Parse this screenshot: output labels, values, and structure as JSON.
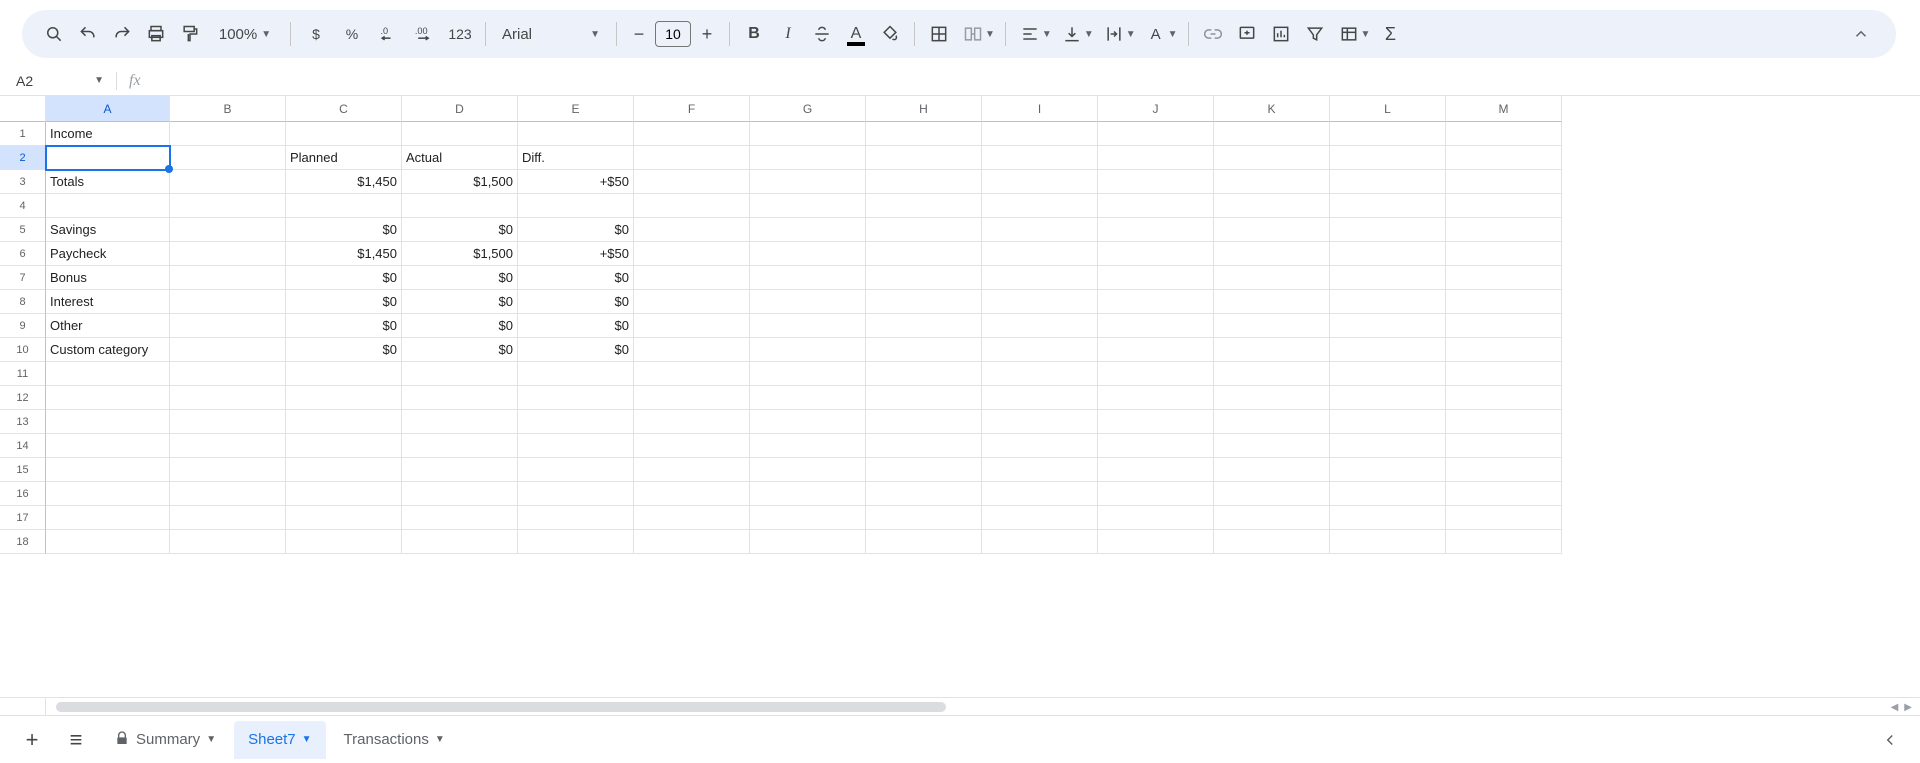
{
  "toolbar": {
    "zoom": "100%",
    "currency_symbol": "$",
    "percent_symbol": "%",
    "dec_less_label": ".0",
    "dec_more_label": ".00",
    "num_format_label": "123",
    "font_name": "Arial",
    "font_size": "10"
  },
  "name_box": {
    "ref": "A2"
  },
  "formula_bar": {
    "value": ""
  },
  "columns": [
    "A",
    "B",
    "C",
    "D",
    "E",
    "F",
    "G",
    "H",
    "I",
    "J",
    "K",
    "L",
    "M"
  ],
  "active_cell": "A2",
  "rows": [
    {
      "n": 1,
      "cells": {
        "A": "Income"
      }
    },
    {
      "n": 2,
      "cells": {
        "C": "Planned",
        "D": "Actual",
        "E": "Diff."
      }
    },
    {
      "n": 3,
      "cells": {
        "A": "Totals",
        "C": "$1,450",
        "D": "$1,500",
        "E": "+$50"
      }
    },
    {
      "n": 4,
      "cells": {}
    },
    {
      "n": 5,
      "cells": {
        "A": "Savings",
        "C": "$0",
        "D": "$0",
        "E": "$0"
      }
    },
    {
      "n": 6,
      "cells": {
        "A": "Paycheck",
        "C": "$1,450",
        "D": "$1,500",
        "E": "+$50"
      }
    },
    {
      "n": 7,
      "cells": {
        "A": "Bonus",
        "C": "$0",
        "D": "$0",
        "E": "$0"
      }
    },
    {
      "n": 8,
      "cells": {
        "A": "Interest",
        "C": "$0",
        "D": "$0",
        "E": "$0"
      }
    },
    {
      "n": 9,
      "cells": {
        "A": "Other",
        "C": "$0",
        "D": "$0",
        "E": "$0"
      }
    },
    {
      "n": 10,
      "cells": {
        "A": "Custom category",
        "C": "$0",
        "D": "$0",
        "E": "$0"
      }
    },
    {
      "n": 11,
      "cells": {}
    },
    {
      "n": 12,
      "cells": {}
    },
    {
      "n": 13,
      "cells": {}
    },
    {
      "n": 14,
      "cells": {}
    },
    {
      "n": 15,
      "cells": {}
    },
    {
      "n": 16,
      "cells": {}
    },
    {
      "n": 17,
      "cells": {}
    },
    {
      "n": 18,
      "cells": {}
    }
  ],
  "sheet_tabs": {
    "tabs": [
      {
        "id": "summary",
        "label": "Summary",
        "locked": true,
        "active": false
      },
      {
        "id": "sheet7",
        "label": "Sheet7",
        "locked": false,
        "active": true
      },
      {
        "id": "transactions",
        "label": "Transactions",
        "locked": false,
        "active": false
      }
    ]
  },
  "colors": {
    "selection_blue": "#1a73e8",
    "header_sel_bg": "#d3e3fd",
    "toolbar_bg": "#edf2fa",
    "active_tab_bg": "#e8f0fe"
  }
}
